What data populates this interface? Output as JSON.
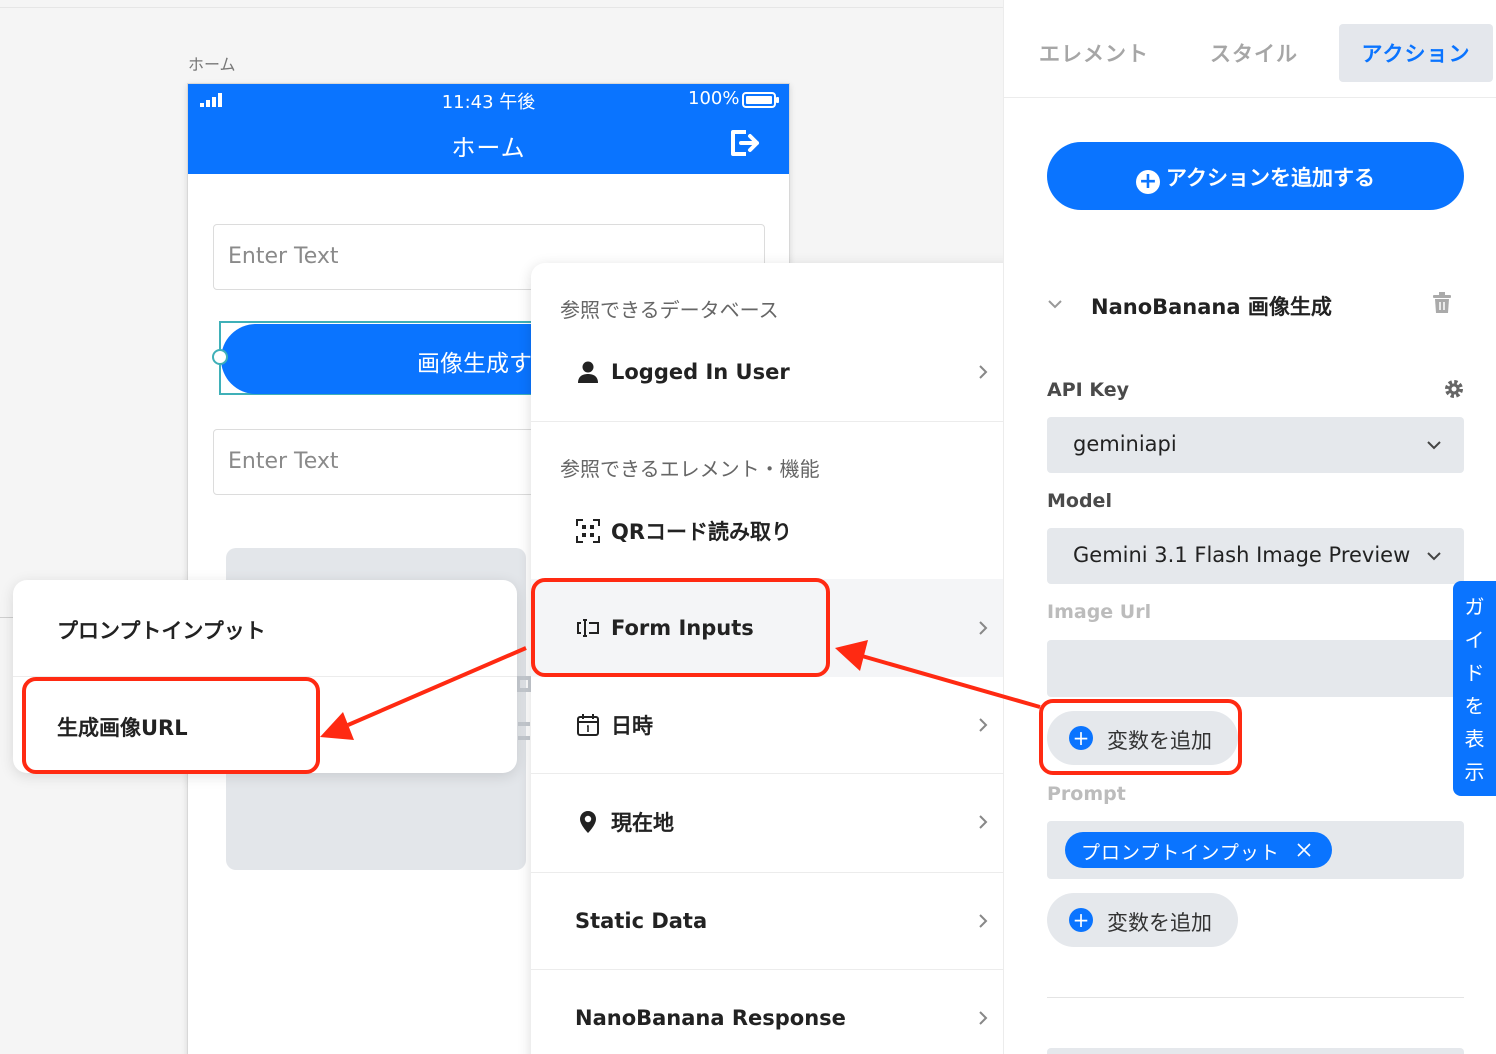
{
  "canvas": {
    "screen_label": "ホーム",
    "phone": {
      "status_time": "11:43 午後",
      "battery": "100%",
      "title": "ホーム",
      "input1_placeholder": "Enter Text",
      "input2_placeholder": "Enter Text",
      "button_label": "画像生成す"
    }
  },
  "variable_menu": {
    "database_section": "参照できるデータベース",
    "logged_in_user": "Logged In User",
    "element_section": "参照できるエレメント・機能",
    "qr_reader": "QRコード読み取り",
    "form_inputs": "Form Inputs",
    "datetime": "日時",
    "location": "現在地",
    "static_data": "Static Data",
    "nanobanana_response": "NanoBanana Response"
  },
  "form_inputs_submenu": {
    "items": [
      "プロンプトインプット",
      "生成画像URL"
    ]
  },
  "panel": {
    "tabs": [
      "エレメント",
      "スタイル",
      "アクション"
    ],
    "active_tab": "アクション",
    "add_action_label": "アクションを追加する",
    "action_name": "NanoBanana 画像生成",
    "api_key_label": "API Key",
    "api_key_value": "geminiapi",
    "model_label": "Model",
    "model_value": "Gemini 3.1 Flash Image Preview",
    "image_url_label": "Image Url",
    "add_variable_label": "変数を追加",
    "prompt_label": "Prompt",
    "prompt_chip": "プロンプトインプット",
    "add_variable_label_2": "変数を追加"
  },
  "guide_tab": "ガイドを表示",
  "colors": {
    "accent": "#0a74ff",
    "annotation": "#ff2a12",
    "field_bg": "#e5e8ec"
  }
}
